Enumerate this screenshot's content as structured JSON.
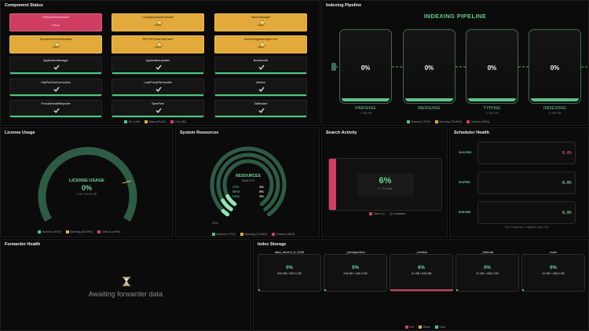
{
  "component_status": {
    "title": "Component Status",
    "rows": [
      [
        {
          "name": "FileInputTimeHandler",
          "status": "Critical",
          "level": "crit"
        },
        {
          "name": "LocalAppsAdminHandler",
          "status": "Yellow",
          "level": "warn"
        },
        {
          "name": "AdminManager",
          "status": "Yellow",
          "level": "warn"
        }
      ],
      [
        {
          "name": "DispatchSearchMetadata",
          "status": "Yellow",
          "level": "warn"
        },
        {
          "name": "RFC7617UserSiteToken",
          "status": "Yellow",
          "level": "warn"
        },
        {
          "name": "AuthStorageManagerConf",
          "status": "Yellow",
          "level": "warn"
        }
      ],
      [
        {
          "name": "ApplicationManager",
          "status": "",
          "level": "ok"
        },
        {
          "name": "ApplicationUpdater",
          "status": "",
          "level": "ok"
        },
        {
          "name": "BundlesUtil",
          "status": "",
          "level": "ok"
        }
      ],
      [
        {
          "name": "HttpPubSubConnection",
          "status": "",
          "level": "ok"
        },
        {
          "name": "LoadProxyFileHandler",
          "status": "",
          "level": "ok"
        },
        {
          "name": "Metrics",
          "status": "",
          "level": "ok"
        }
      ],
      [
        {
          "name": "PeriodicHealthReporter",
          "status": "",
          "level": "ok"
        },
        {
          "name": "SpecFiles",
          "status": "",
          "level": "ok"
        },
        {
          "name": "TailReader",
          "status": "",
          "level": "ok"
        }
      ]
    ],
    "legend": [
      "OK (<60)",
      "Warn (60-80)",
      "Crit (>80)"
    ]
  },
  "indexing_pipeline": {
    "title": "Indexing Pipeline",
    "heading": "INDEXING PIPELINE",
    "stages": [
      {
        "name": "PARSING",
        "pct": "0%",
        "sub": "1 / 500 KB",
        "fill": 0.04
      },
      {
        "name": "MERGING",
        "pct": "0%",
        "sub": "",
        "fill": 0.04
      },
      {
        "name": "TYPING",
        "pct": "0%",
        "sub": "1 / 500 KB",
        "fill": 0.04
      },
      {
        "name": "INDEXING",
        "pct": "0%",
        "sub": "1 / 500 KB",
        "fill": 0.04
      }
    ],
    "legend": [
      "Normal (<70%)",
      "Warning (70-85%)",
      "Critical (>85%)"
    ]
  },
  "license_usage": {
    "title": "License Usage",
    "label": "LICENSE USAGE",
    "pct": "0%",
    "sub": "0.00 / 50.00 GB",
    "fraction": 0.0,
    "legend": [
      "Normal (<80%)",
      "Warning (80-99%)",
      "Critical (>99%)"
    ]
  },
  "system_resources": {
    "title": "System Resources",
    "heading": "RESOURCES",
    "status": "HEALTHY",
    "metrics": [
      {
        "name": "CPU",
        "value": "3%"
      },
      {
        "name": "MEM",
        "value": "8%"
      },
      {
        "name": "DISK",
        "value": "9%"
      }
    ],
    "axis_label": "CPU",
    "legend": [
      "Normal (<70%)",
      "Warning (70-85%)",
      "Critical (>85%)"
    ]
  },
  "search_activity": {
    "title": "Search Activity",
    "pct": "6%",
    "sub": "2 / 30 slots",
    "fraction": 0.06,
    "legend": [
      "Other (1)",
      "Available"
    ]
  },
  "scheduler_health": {
    "title": "Scheduler Health",
    "rows": [
      {
        "label": "SUCCESS",
        "value": "0.0%",
        "color": "#e0507a"
      },
      {
        "label": "SKIPPED",
        "value": "0.0%",
        "color": "#6ed89d"
      },
      {
        "label": "RUNTIME",
        "value": "0.0%",
        "color": "#6ed89d"
      }
    ],
    "footer": "Run: 0 searches / 0 skipped / Avg: 0.0s"
  },
  "forwarder_health": {
    "title": "Forwarder Health",
    "icon": "hourglass-icon",
    "message": "Awaiting forwarder data"
  },
  "index_storage": {
    "title": "Index Storage",
    "indexes": [
      {
        "name": "data_drivers_fl_2025",
        "pct": "0%",
        "size": "643 MB / 500.0 GB",
        "fraction": 0.02
      },
      {
        "name": "_introspection",
        "pct": "0%",
        "size": "246 MB / 488.3 GB",
        "fraction": 0.02
      },
      {
        "name": "_metrics",
        "pct": "6%",
        "size": "41 MB / 645 MB",
        "fraction": 0.99,
        "hot": true
      },
      {
        "name": "_internal",
        "pct": "0%",
        "size": "31 MB / 488.3 GB",
        "fraction": 0.02
      },
      {
        "name": "main",
        "pct": "0%",
        "size": "10 MB / 488.3 GB",
        "fraction": 0.02
      }
    ],
    "legend": [
      "Hot",
      "Warm",
      "Cold"
    ]
  },
  "colors": {
    "ok": "#47c97e",
    "warn": "#e2a93b",
    "crit": "#cf3d63",
    "ring": "#2e5b45",
    "accent": "#6ed89d"
  }
}
